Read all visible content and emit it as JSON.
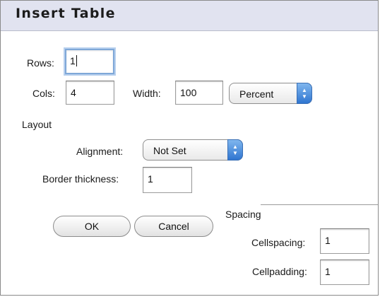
{
  "dialog": {
    "title": "Insert Table"
  },
  "rows": {
    "label": "Rows:",
    "value": "1"
  },
  "cols": {
    "label": "Cols:",
    "value": "4"
  },
  "width": {
    "label": "Width:",
    "value": "100",
    "unit_selected": "Percent"
  },
  "layout": {
    "section_label": "Layout",
    "alignment": {
      "label": "Alignment:",
      "selected": "Not Set"
    },
    "border": {
      "label": "Border thickness:",
      "value": "1"
    }
  },
  "buttons": {
    "ok": "OK",
    "cancel": "Cancel"
  },
  "spacing": {
    "section_label": "Spacing",
    "cellspacing": {
      "label": "Cellspacing:",
      "value": "1"
    },
    "cellpadding": {
      "label": "Cellpadding:",
      "value": "1"
    }
  },
  "icons": {
    "select_arrow": "up-down-chevron-icon"
  },
  "colors": {
    "title_bar": "#e1e3f0",
    "select_arrow": "#3d82d9",
    "focus_ring": "#7fa8d8"
  }
}
